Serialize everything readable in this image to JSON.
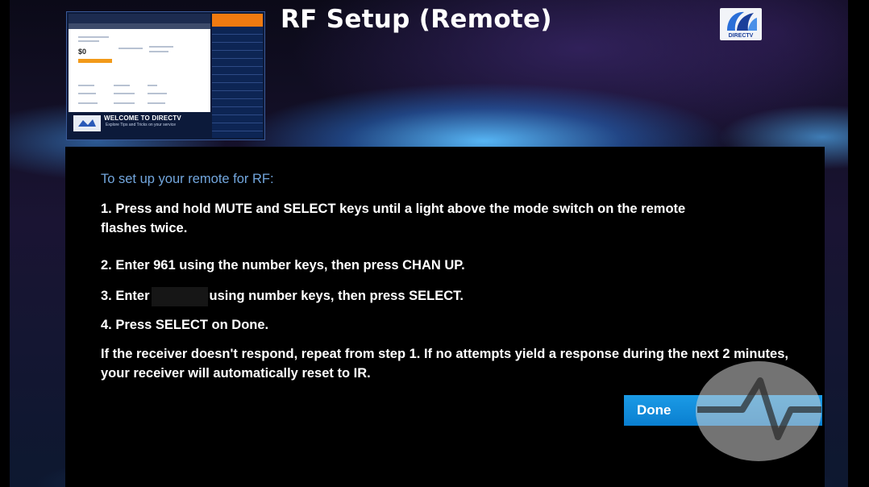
{
  "screen": {
    "title": "RF Setup (Remote)",
    "logo_text": "DIRECTV"
  },
  "preview": {
    "welcome_title": "WELCOME TO DIRECTV",
    "welcome_subtitle": "Explore Tips and Tricks on your service",
    "price": "$0"
  },
  "content": {
    "heading": "To set up your remote for RF:",
    "step1": "1. Press and hold MUTE and SELECT keys until a light above the mode switch on the remote flashes twice.",
    "step2": "2. Enter 961 using the number keys, then press CHAN UP.",
    "step3_prefix": "3. Enter",
    "step3_suffix": "using number keys, then press SELECT.",
    "step4": "4. Press SELECT on Done.",
    "note": "If the receiver doesn't respond, repeat from step 1. If no attempts yield a response during the next 2 minutes, your receiver will automatically reset to IR."
  },
  "actions": {
    "done_label": "Done"
  },
  "colors": {
    "heading": "#72a6dd",
    "button": "#0a7fd0",
    "panel": "#000000"
  }
}
